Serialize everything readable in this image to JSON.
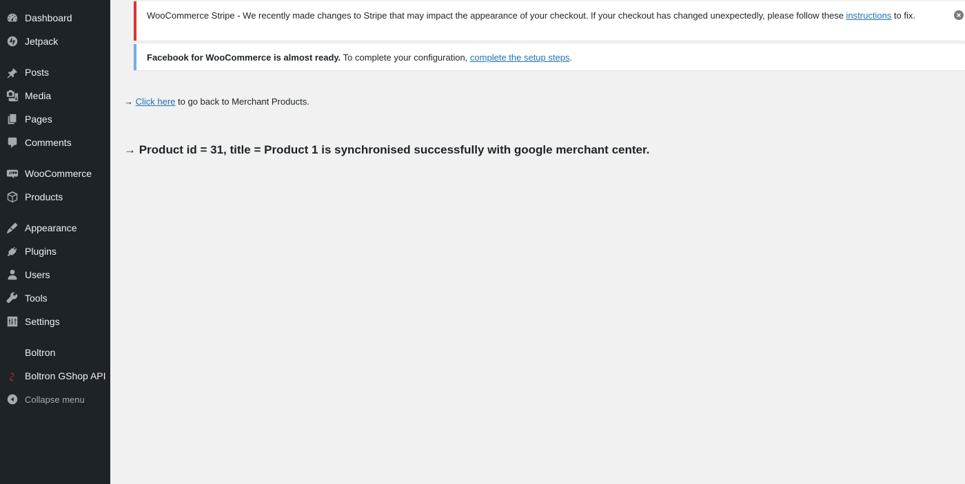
{
  "sidebar": {
    "items": [
      {
        "label": "Dashboard",
        "icon": "dashboard-icon"
      },
      {
        "label": "Jetpack",
        "icon": "jetpack-icon"
      },
      {
        "label": "Posts",
        "icon": "pin-icon"
      },
      {
        "label": "Media",
        "icon": "media-icon"
      },
      {
        "label": "Pages",
        "icon": "pages-icon"
      },
      {
        "label": "Comments",
        "icon": "comment-icon"
      },
      {
        "label": "WooCommerce",
        "icon": "woocommerce-icon"
      },
      {
        "label": "Products",
        "icon": "products-box-icon"
      },
      {
        "label": "Appearance",
        "icon": "brush-icon"
      },
      {
        "label": "Plugins",
        "icon": "plug-icon"
      },
      {
        "label": "Users",
        "icon": "user-icon"
      },
      {
        "label": "Tools",
        "icon": "wrench-icon"
      },
      {
        "label": "Settings",
        "icon": "sliders-icon"
      },
      {
        "label": "Boltron",
        "icon": ""
      },
      {
        "label": "Boltron GShop API",
        "icon": "boltron-logo-icon"
      },
      {
        "label": "Collapse menu",
        "icon": "collapse-arrow-icon"
      }
    ]
  },
  "notices": {
    "stripe": {
      "text_before": "WooCommerce Stripe - We recently made changes to Stripe that may impact the appearance of your checkout. If your checkout has changed unexpectedly, please follow these ",
      "link": "instructions",
      "text_after": " to fix."
    },
    "facebook": {
      "bold": "Facebook for WooCommerce is almost ready.",
      "text": " To complete your configuration, ",
      "link": "complete the setup steps",
      "text_after": "."
    }
  },
  "main": {
    "back_arrow": "→",
    "back_link": "Click here",
    "back_text": " to go back to Merchant Products.",
    "result_message": "→ Product id = 31, title = Product 1 is synchronised successfully with google merchant center."
  },
  "colors": {
    "sidebar_bg": "#1d2327",
    "error_border": "#d63638",
    "info_border": "#72aee6",
    "link": "#2271b1"
  }
}
